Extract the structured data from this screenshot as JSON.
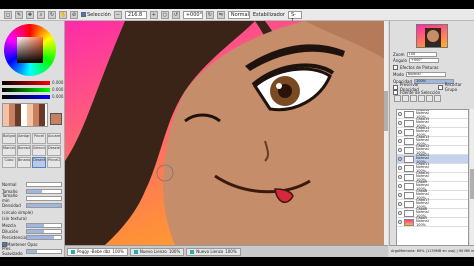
{
  "toolbar": {
    "checkbox_label": "Selección",
    "zoom_value": "216.8",
    "rotation_value": "+000°",
    "blend_mode": "Normal",
    "stabilizer_label": "Estabilizador",
    "stabilizer_value": "S-1"
  },
  "color_panel": {
    "slider_values": [
      "0.000",
      "0.000",
      "0.000"
    ]
  },
  "tools": [
    {
      "label": "Boligrafo"
    },
    {
      "label": "Aerógrafo"
    },
    {
      "label": "Pincel"
    },
    {
      "label": "Acuarela"
    },
    {
      "label": "Marcador"
    },
    {
      "label": "Borrador"
    },
    {
      "label": "Selección"
    },
    {
      "label": "Deselec"
    },
    {
      "label": "Cubo"
    },
    {
      "label": "Binario"
    },
    {
      "label": "Desenfoque"
    },
    {
      "label": "Pincel2"
    }
  ],
  "brush_props": {
    "mode": "Normal",
    "size_label": "Tamaño",
    "size_value": "x1.0",
    "min_size_label": "Tamaño min",
    "min_size_value": "0%",
    "density_label": "Densidad",
    "density_value": "100",
    "shape_label": "(circulo simple)",
    "texture_label": "(sin textura)",
    "blend_label": "Mezcla",
    "blend_value": "50",
    "dilution_label": "Dilución",
    "dilution_value": "50",
    "persistence_label": "Persistencia",
    "persistence_value": "80",
    "keep_opacity_label": "Mantener Opac",
    "pressure_label": "Pres. Suavizado",
    "pressure_value": "30%"
  },
  "tabs": [
    {
      "label": "Peggy -Bebe dbz",
      "zoom": "100%"
    },
    {
      "label": "Nuevo Lienzo",
      "zoom": "100%"
    },
    {
      "label": "Nuevo Lienzo",
      "zoom": "100%"
    }
  ],
  "right_panel": {
    "zoom_label": "Zoom",
    "zoom_value": "100",
    "angle_label": "Ángulo",
    "angle_value": "+000°",
    "effects_label": "Efectos de Pinturas",
    "mode_label": "Modo",
    "mode_value": "Normal",
    "opacity_label": "Opacidad",
    "opacity_value": "100%",
    "preserve_label": "Preservar Opacidad",
    "clipping_label": "Recortar Grupo",
    "selection_source_label": "Fuente de Selección"
  },
  "layers": [
    {
      "name": "Capa16",
      "mode": "Normal",
      "opacity": "100%",
      "color": false
    },
    {
      "name": "Capa15",
      "mode": "Normal",
      "opacity": "100%",
      "color": false
    },
    {
      "name": "Capa14",
      "mode": "Normal",
      "opacity": "100%",
      "color": false
    },
    {
      "name": "Capa13",
      "mode": "Normal",
      "opacity": "100%",
      "color": false
    },
    {
      "name": "Capa12",
      "mode": "Normal",
      "opacity": "100%",
      "color": false
    },
    {
      "name": "Capa22",
      "mode": "Normal",
      "opacity": "100%",
      "color": false,
      "selected": true
    },
    {
      "name": "Capa11",
      "mode": "Normal",
      "opacity": "100%",
      "color": false
    },
    {
      "name": "Capa10",
      "mode": "Normal",
      "opacity": "100%",
      "color": false
    },
    {
      "name": "Capa9",
      "mode": "Normal",
      "opacity": "100%",
      "color": false
    },
    {
      "name": "Capa8",
      "mode": "Normal",
      "opacity": "100%",
      "color": false
    },
    {
      "name": "Capa17",
      "mode": "Normal",
      "opacity": "100%",
      "color": false
    },
    {
      "name": "Capa6",
      "mode": "Normal",
      "opacity": "100%",
      "color": false
    },
    {
      "name": "Capa5",
      "mode": "Normal",
      "opacity": "100%",
      "color": true
    }
  ],
  "status": {
    "text": "ArgoMemoria: 60% (1139MB en uso) | 90 MB reservado 100%"
  }
}
